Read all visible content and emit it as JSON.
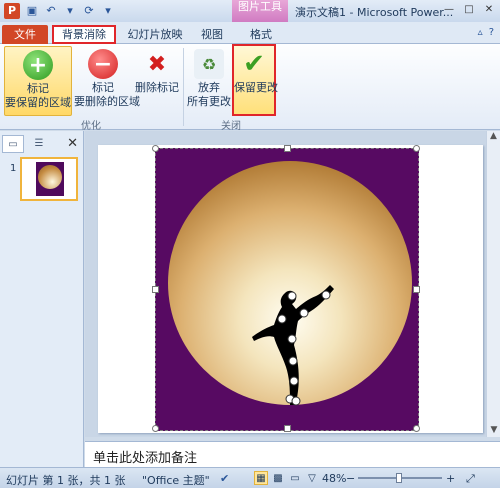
{
  "app": {
    "icon_letter": "P",
    "title": "演示文稿1 - Microsoft Power...",
    "context_tab_label": "图片工具"
  },
  "tabs": {
    "file": "文件",
    "background_removal": "背景消除",
    "slideshow": "幻灯片放映",
    "view": "视图",
    "format": "格式"
  },
  "ribbon": {
    "mark_keep": {
      "line1": "标记",
      "line2": "要保留的区域"
    },
    "mark_remove": {
      "line1": "标记",
      "line2": "要删除的区域"
    },
    "delete_mark": "删除标记",
    "discard": {
      "line1": "放弃",
      "line2": "所有更改"
    },
    "keep_changes": "保留更改",
    "group_refine": "优化",
    "group_close": "关闭"
  },
  "slides_panel": {
    "slide_number": "1"
  },
  "notes": {
    "placeholder": "单击此处添加备注"
  },
  "status": {
    "slide_info": "幻灯片 第 1 张，共 1 张",
    "theme": "\"Office 主题\"",
    "zoom": "48%"
  },
  "colors": {
    "picture_background": "#570a62",
    "accent_red": "#e0262a",
    "file_tab": "#d24726",
    "highlight": "#ffd867"
  }
}
